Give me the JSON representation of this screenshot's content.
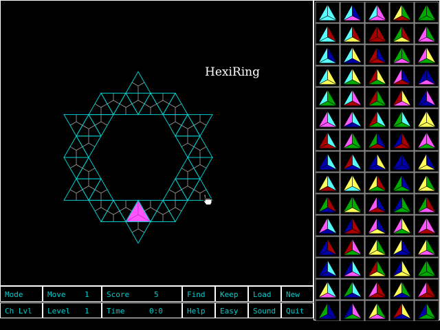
{
  "game": {
    "title": "HexiRing"
  },
  "controls": {
    "mode": "Mode",
    "move_label": "Move",
    "move_value": "1",
    "score_label": "Score",
    "score_value": "5",
    "find": "Find",
    "keep": "Keep",
    "load": "Load",
    "new": "New",
    "change_level": "Ch Lvl",
    "level_label": "Level",
    "level_value": "1",
    "time_label": "Time",
    "time_value": "0:0",
    "help": "Help",
    "easy": "Easy",
    "sound": "Sound",
    "quit": "Quit"
  },
  "colors": {
    "grid": "#00cccc",
    "inner_lines": "#aaaaaa",
    "placed": "#ff55ff",
    "cyan": "#55ffff",
    "magenta": "#ff55ff",
    "red": "#aa0000",
    "green": "#00aa00",
    "blue": "#0000aa",
    "yellow": "#ffff55"
  },
  "placed_tile": {
    "slot": "bottom-center",
    "colors": [
      "magenta",
      "magenta",
      "magenta"
    ]
  },
  "palette": [
    [
      [
        "cyan",
        "cyan",
        "cyan"
      ],
      [
        "cyan",
        "blue",
        "magenta"
      ],
      [
        "cyan",
        "magenta",
        "magenta"
      ],
      [
        "yellow",
        "green",
        "red"
      ],
      [
        "green",
        "green",
        "green"
      ]
    ],
    [
      [
        "cyan",
        "red",
        "cyan"
      ],
      [
        "cyan",
        "red",
        "yellow"
      ],
      [
        "red",
        "red",
        "red"
      ],
      [
        "green",
        "red",
        "yellow"
      ],
      [
        "magenta",
        "green",
        "magenta"
      ]
    ],
    [
      [
        "cyan",
        "blue",
        "cyan"
      ],
      [
        "cyan",
        "yellow",
        "blue"
      ],
      [
        "red",
        "blue",
        "red"
      ],
      [
        "green",
        "green",
        "magenta"
      ],
      [
        "magenta",
        "yellow",
        "green"
      ]
    ],
    [
      [
        "cyan",
        "yellow",
        "yellow"
      ],
      [
        "cyan",
        "yellow",
        "green"
      ],
      [
        "red",
        "yellow",
        "green"
      ],
      [
        "magenta",
        "blue",
        "red"
      ],
      [
        "blue",
        "blue",
        "magenta"
      ]
    ],
    [
      [
        "cyan",
        "green",
        "green"
      ],
      [
        "cyan",
        "magenta",
        "red"
      ],
      [
        "red",
        "green",
        "green"
      ],
      [
        "red",
        "yellow",
        "magenta"
      ],
      [
        "blue",
        "magenta",
        "blue"
      ]
    ],
    [
      [
        "magenta",
        "cyan",
        "magenta"
      ],
      [
        "magenta",
        "cyan",
        "blue"
      ],
      [
        "red",
        "cyan",
        "green"
      ],
      [
        "green",
        "cyan",
        "green"
      ],
      [
        "yellow",
        "yellow",
        "yellow"
      ]
    ],
    [
      [
        "red",
        "cyan",
        "red"
      ],
      [
        "magenta",
        "green",
        "green"
      ],
      [
        "green",
        "blue",
        "red"
      ],
      [
        "blue",
        "red",
        "red"
      ],
      [
        "magenta",
        "magenta",
        "green"
      ]
    ],
    [
      [
        "blue",
        "cyan",
        "blue"
      ],
      [
        "red",
        "cyan",
        "blue"
      ],
      [
        "blue",
        "yellow",
        "blue"
      ],
      [
        "blue",
        "blue",
        "blue"
      ],
      [
        "yellow",
        "blue",
        "yellow"
      ]
    ],
    [
      [
        "yellow",
        "cyan",
        "red"
      ],
      [
        "yellow",
        "yellow",
        "cyan"
      ],
      [
        "yellow",
        "red",
        "green"
      ],
      [
        "green",
        "blue",
        "green"
      ],
      [
        "yellow",
        "green",
        "yellow"
      ]
    ],
    [
      [
        "green",
        "red",
        "blue"
      ],
      [
        "green",
        "green",
        "yellow"
      ],
      [
        "magenta",
        "blue",
        "red"
      ],
      [
        "blue",
        "green",
        "green"
      ],
      [
        "green",
        "red",
        "magenta"
      ]
    ],
    [
      [
        "magenta",
        "cyan",
        "blue"
      ],
      [
        "blue",
        "red",
        "red"
      ],
      [
        "magenta",
        "blue",
        "yellow"
      ],
      [
        "magenta",
        "yellow",
        "green"
      ],
      [
        "magenta",
        "magenta",
        "red"
      ]
    ],
    [
      [
        "blue",
        "red",
        "blue"
      ],
      [
        "red",
        "magenta",
        "green"
      ],
      [
        "yellow",
        "green",
        "yellow"
      ],
      [
        "yellow",
        "blue",
        "blue"
      ],
      [
        "yellow",
        "green",
        "magenta"
      ]
    ],
    [
      [
        "blue",
        "cyan",
        "blue"
      ],
      [
        "blue",
        "cyan",
        "magenta"
      ],
      [
        "red",
        "green",
        "yellow"
      ],
      [
        "blue",
        "yellow",
        "yellow"
      ],
      [
        "green",
        "green",
        "green"
      ]
    ],
    [
      [
        "yellow",
        "cyan",
        "magenta"
      ],
      [
        "green",
        "cyan",
        "blue"
      ],
      [
        "magenta",
        "red",
        "red"
      ],
      [
        "yellow",
        "green",
        "blue"
      ],
      [
        "magenta",
        "red",
        "red"
      ]
    ],
    [
      [
        "green",
        "blue",
        "blue"
      ],
      [
        "blue",
        "magenta",
        "green"
      ],
      [
        "yellow",
        "green",
        "magenta"
      ],
      [
        "red",
        "yellow",
        "blue"
      ],
      [
        "blue",
        "green",
        "green"
      ]
    ]
  ]
}
